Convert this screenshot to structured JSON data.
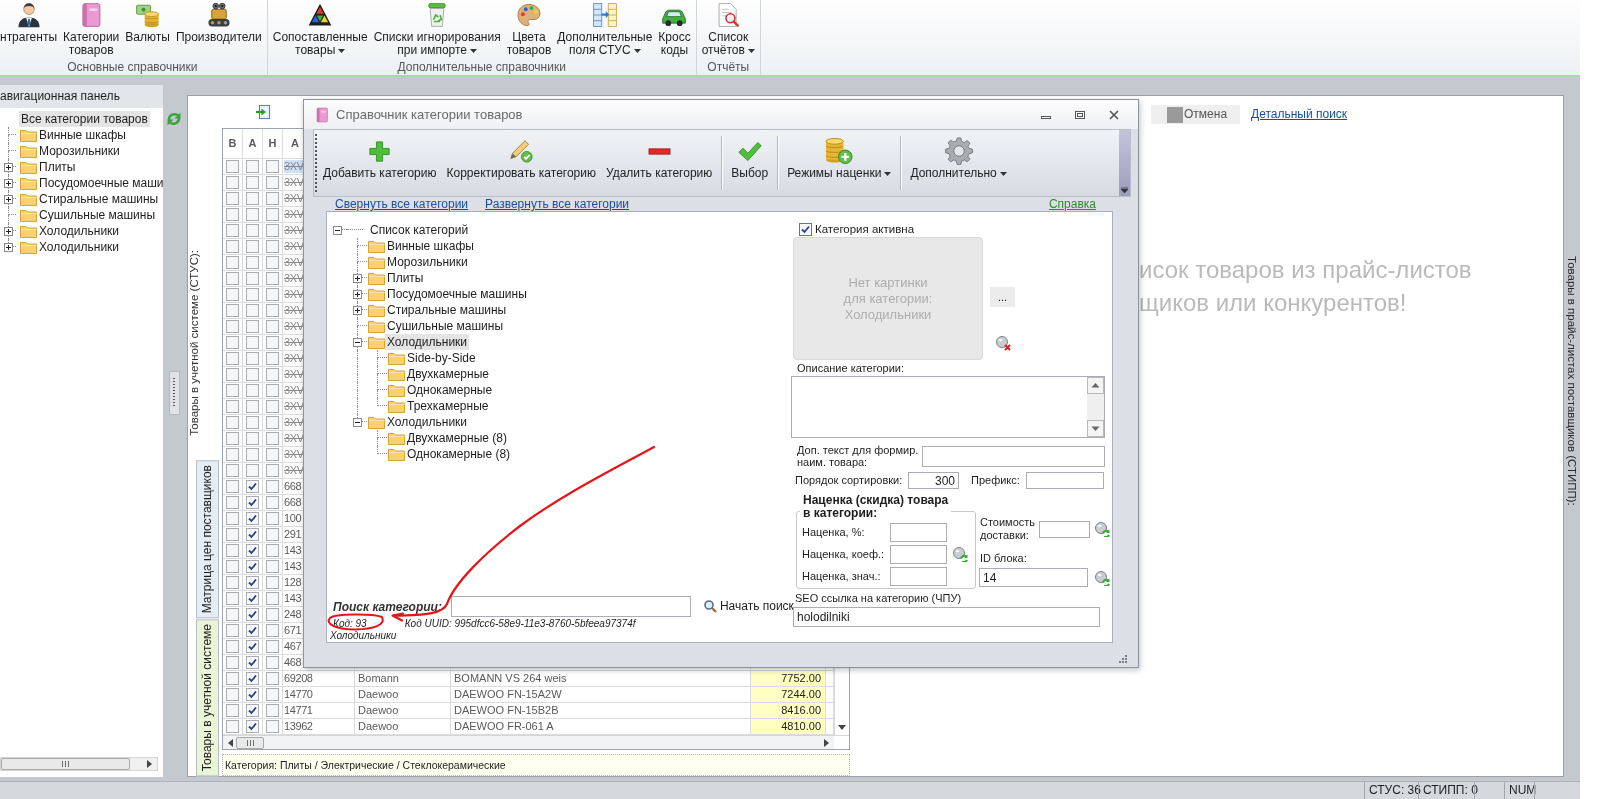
{
  "ribbon": {
    "groups": [
      {
        "label": "Основные справочники",
        "buttons": [
          {
            "label": "нтрагенты",
            "dropdown": false
          },
          {
            "label": "Категории\nтоваров",
            "dropdown": false
          },
          {
            "label": "Валюты",
            "dropdown": false
          },
          {
            "label": "Производители",
            "dropdown": false
          }
        ]
      },
      {
        "label": "Дополнительные справочники",
        "buttons": [
          {
            "label": "Сопоставленные\nтовары",
            "dropdown": true
          },
          {
            "label": "Списки игнорирования\nпри импорте",
            "dropdown": true
          },
          {
            "label": "Цвета\nтоваров",
            "dropdown": false
          },
          {
            "label": "Дополнительные\nполя СТУС",
            "dropdown": true
          },
          {
            "label": "Кросс\nкоды",
            "dropdown": false
          }
        ]
      },
      {
        "label": "Отчёты",
        "buttons": [
          {
            "label": "Список\nотчётов",
            "dropdown": true
          }
        ]
      }
    ]
  },
  "navigation_panel": {
    "title": "авигационная панель",
    "tree": {
      "label": "Все категории товаров",
      "selected": true,
      "children": [
        {
          "label": "Винные шкафы",
          "selected": false
        },
        {
          "label": "Морозильники",
          "selected": false
        },
        {
          "label": "Плиты",
          "selected": false,
          "expanded": false
        },
        {
          "label": "Посудомоечные маши",
          "selected": false,
          "expanded": false
        },
        {
          "label": "Стиральные машины",
          "selected": false,
          "expanded": false
        },
        {
          "label": "Сушильные машины",
          "selected": false
        },
        {
          "label": "Холодильники",
          "selected": false,
          "expanded": false
        },
        {
          "label": "Холодильники",
          "selected": false,
          "expanded": false
        }
      ]
    }
  },
  "main": {
    "caption": "Товары в учетной системе (СТУС):",
    "tabs": [
      {
        "label": "Матрица цен поставщиков",
        "selected": false
      },
      {
        "label": "Товары в учетной системе",
        "selected": true
      }
    ],
    "grid": {
      "columns": [
        "В",
        "А",
        "Н",
        "А"
      ],
      "rows": [
        {
          "checks": [
            false,
            false,
            false
          ],
          "code": "3XV",
          "crossed_out": true,
          "selected": true
        },
        {
          "checks": [
            false,
            false,
            false
          ],
          "code": "3XV",
          "crossed_out": true,
          "selected": false
        },
        {
          "checks": [
            false,
            false,
            false
          ],
          "code": "3XV",
          "crossed_out": true,
          "selected": false
        },
        {
          "checks": [
            false,
            false,
            false
          ],
          "code": "3XV",
          "crossed_out": true,
          "selected": false
        },
        {
          "checks": [
            false,
            false,
            false
          ],
          "code": "3XV",
          "crossed_out": true,
          "selected": false
        },
        {
          "checks": [
            false,
            false,
            false
          ],
          "code": "3XV",
          "crossed_out": true,
          "selected": false
        },
        {
          "checks": [
            false,
            false,
            false
          ],
          "code": "3XV",
          "crossed_out": true,
          "selected": false
        },
        {
          "checks": [
            false,
            false,
            false
          ],
          "code": "3XV",
          "crossed_out": true,
          "selected": false
        },
        {
          "checks": [
            false,
            false,
            false
          ],
          "code": "3XV",
          "crossed_out": true,
          "selected": false
        },
        {
          "checks": [
            false,
            false,
            false
          ],
          "code": "3XV",
          "crossed_out": true,
          "selected": false
        },
        {
          "checks": [
            false,
            false,
            false
          ],
          "code": "3XV",
          "crossed_out": true,
          "selected": false
        },
        {
          "checks": [
            false,
            false,
            false
          ],
          "code": "3XV",
          "crossed_out": true,
          "selected": false
        },
        {
          "checks": [
            false,
            false,
            false
          ],
          "code": "3XV",
          "crossed_out": true,
          "selected": false
        },
        {
          "checks": [
            false,
            false,
            false
          ],
          "code": "3XV",
          "crossed_out": true,
          "selected": false
        },
        {
          "checks": [
            false,
            false,
            false
          ],
          "code": "3XV",
          "crossed_out": true,
          "selected": false
        },
        {
          "checks": [
            false,
            false,
            false
          ],
          "code": "3XV",
          "crossed_out": true,
          "selected": false
        },
        {
          "checks": [
            false,
            false,
            false
          ],
          "code": "3XV",
          "crossed_out": true,
          "selected": false
        },
        {
          "checks": [
            false,
            false,
            false
          ],
          "code": "3XV",
          "crossed_out": true,
          "selected": false
        },
        {
          "checks": [
            false,
            false,
            false
          ],
          "code": "3XV",
          "crossed_out": true,
          "selected": false
        },
        {
          "checks": [
            false,
            false,
            false
          ],
          "code": "3XV",
          "crossed_out": true,
          "selected": false
        },
        {
          "checks": [
            false,
            true,
            false
          ],
          "code": "668",
          "crossed_out": false,
          "selected": false
        },
        {
          "checks": [
            false,
            true,
            false
          ],
          "code": "668",
          "crossed_out": false,
          "selected": false
        },
        {
          "checks": [
            false,
            true,
            false
          ],
          "code": "100",
          "crossed_out": false,
          "selected": false
        },
        {
          "checks": [
            false,
            true,
            false
          ],
          "code": "291",
          "crossed_out": false,
          "selected": false
        },
        {
          "checks": [
            false,
            true,
            false
          ],
          "code": "143",
          "crossed_out": false,
          "selected": false
        },
        {
          "checks": [
            false,
            true,
            false
          ],
          "code": "143",
          "crossed_out": false,
          "selected": false
        },
        {
          "checks": [
            false,
            true,
            false
          ],
          "code": "128",
          "crossed_out": false,
          "selected": false
        },
        {
          "checks": [
            false,
            true,
            false
          ],
          "code": "143",
          "crossed_out": false,
          "selected": false
        },
        {
          "checks": [
            false,
            true,
            false
          ],
          "code": "248",
          "crossed_out": false,
          "selected": false
        },
        {
          "checks": [
            false,
            true,
            false
          ],
          "code": "671",
          "crossed_out": false,
          "selected": false
        },
        {
          "checks": [
            false,
            true,
            false
          ],
          "code": "467",
          "crossed_out": false,
          "selected": false
        },
        {
          "checks": [
            false,
            true,
            false
          ],
          "code": "468",
          "crossed_out": false,
          "selected": false
        },
        {
          "checks": [
            false,
            true,
            false
          ],
          "code": "69208",
          "crossed_out": false,
          "selected": false,
          "brand": "Bomann",
          "name": "BOMANN VS 264 weis",
          "price": "7752.00"
        },
        {
          "checks": [
            false,
            true,
            false
          ],
          "code": "14770",
          "crossed_out": false,
          "selected": false,
          "brand": "Daewoo",
          "name": "DAEWOO FN-15A2W",
          "price": "7244.00"
        },
        {
          "checks": [
            false,
            true,
            false
          ],
          "code": "14771",
          "crossed_out": false,
          "selected": false,
          "brand": "Daewoo",
          "name": "DAEWOO FN-15B2B",
          "price": "8416.00"
        },
        {
          "checks": [
            false,
            true,
            false
          ],
          "code": "13962",
          "crossed_out": false,
          "selected": false,
          "brand": "Daewoo",
          "name": "DAEWOO FR-061 A",
          "price": "4810.00"
        }
      ]
    },
    "grid_status": "Категория: Плиты / Электрические / Стеклокерамические",
    "cancel_button": "Отмена",
    "detail_search_link": "Детальный поиск",
    "hint": [
      "исок товаров из прайс-листов",
      "щиков или конкурентов!"
    ],
    "side_tab": "Товары в прайс-листах поставщиков (СТИПП):"
  },
  "dialog": {
    "title": "Справочник категории товаров",
    "toolbar": [
      [
        {
          "label": "Добавить категорию",
          "dropdown": false
        },
        {
          "label": "Корректировать категорию",
          "dropdown": false
        },
        {
          "label": "Удалить категорию",
          "dropdown": false
        }
      ],
      [
        {
          "label": "Выбор",
          "dropdown": false
        }
      ],
      [
        {
          "label": "Режимы наценки",
          "dropdown": true
        }
      ],
      [
        {
          "label": "Дополнительно",
          "dropdown": true
        }
      ]
    ],
    "links": [
      "Свернуть все категории",
      "Развернуть все категории"
    ],
    "help_link": "Справка",
    "tree": {
      "label": "Список категорий",
      "expanded": true,
      "selected": false,
      "children": [
        {
          "label": "Винные шкафы",
          "selected": false
        },
        {
          "label": "Морозильники",
          "selected": false
        },
        {
          "label": "Плиты",
          "selected": false,
          "expanded": false
        },
        {
          "label": "Посудомоечные машины",
          "selected": false,
          "expanded": false
        },
        {
          "label": "Стиральные машины",
          "selected": false,
          "expanded": false
        },
        {
          "label": "Сушильные машины",
          "selected": false
        },
        {
          "label": "Холодильники",
          "selected": true,
          "expanded": true,
          "children": [
            {
              "label": "Side-by-Side",
              "selected": false
            },
            {
              "label": "Двухкамерные",
              "selected": false
            },
            {
              "label": "Однокамерные",
              "selected": false
            },
            {
              "label": "Трехкамерные",
              "selected": false
            }
          ]
        },
        {
          "label": "Холодильники",
          "selected": false,
          "expanded": true,
          "children": [
            {
              "label": "Двухкамерные (8)",
              "selected": false
            },
            {
              "label": "Однокамерные (8)",
              "selected": false
            }
          ]
        }
      ]
    },
    "search": {
      "label": "Поиск категории:",
      "button": "Начать поиск"
    },
    "info": {
      "code": "Код: 93",
      "uuid": "Код UUID: 995dfcc6-58e9-11e3-8760-5bfeea97374f",
      "name": "Холодильники"
    },
    "form": {
      "active": {
        "label": "Категория активна",
        "checked": true
      },
      "image_placeholder": "Нет картинки\nдля категории:\nХолодильники",
      "browse_button": "...",
      "description": {
        "label": "Описание категории:"
      },
      "name_suffix": {
        "label": "Доп. текст для формир.\nнаим. товара:"
      },
      "sort_order": {
        "label": "Порядок сортировки:",
        "value": "300"
      },
      "prefix": {
        "label": "Префикс:"
      },
      "markup": {
        "title": "Наценка (скидка) товара\nв категории:",
        "fields": [
          {
            "label": "Наценка, %:"
          },
          {
            "label": "Наценка, коеф.:"
          },
          {
            "label": "Наценка, знач.:"
          }
        ]
      },
      "delivery_cost": {
        "label": "Стоимость\nдоставки:"
      },
      "block_id": {
        "label": "ID блока:",
        "value": "14"
      },
      "seo": {
        "label": "SEO ссылка на категорию (ЧПУ)",
        "value": "holodilniki"
      }
    }
  },
  "status_bar": [
    "СТУС: 36",
    "СТИПП: 0",
    "NUM"
  ]
}
